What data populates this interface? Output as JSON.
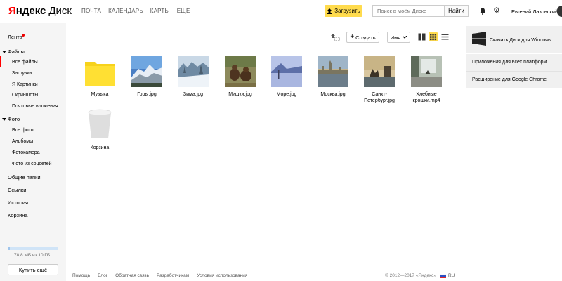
{
  "header": {
    "logo_y": "Я",
    "logo_rest": "ндекс",
    "logo_service": "Диск",
    "nav": [
      "ПОЧТА",
      "КАЛЕНДАРЬ",
      "КАРТЫ",
      "ЕЩЁ"
    ],
    "upload_label": "Загрузить",
    "search_placeholder": "Поиск в моём Диске",
    "search_button": "Найти",
    "username": "Евгений Лазовский"
  },
  "sidebar": {
    "feed": "Лента",
    "files": "Файлы",
    "file_items": [
      "Все файлы",
      "Загрузки",
      "Я Картинки",
      "Скриншоты",
      "Почтовые вложения"
    ],
    "photo": "Фото",
    "photo_items": [
      "Все фото",
      "Альбомы",
      "Фотокамера",
      "Фото из соцсетей"
    ],
    "shared": "Общие папки",
    "links": "Ссылки",
    "history": "История",
    "trash": "Корзина",
    "quota_text": "78,8 МБ из 10 ГБ",
    "quota_fraction": 0.01,
    "buy_more": "Купить ещё"
  },
  "toolbar": {
    "create_label": "Создать",
    "sort_label": "Имя"
  },
  "files": [
    {
      "name": "Музыка",
      "icon": "folder-icon"
    },
    {
      "name": "Горы.jpg",
      "icon": "mountains-photo"
    },
    {
      "name": "Зима.jpg",
      "icon": "winter-photo"
    },
    {
      "name": "Мишки.jpg",
      "icon": "bears-photo"
    },
    {
      "name": "Море.jpg",
      "icon": "sea-photo"
    },
    {
      "name": "Москва.jpg",
      "icon": "moscow-photo"
    },
    {
      "name": "Санкт-",
      "name2": "Петербург.jpg",
      "icon": "spb-photo"
    },
    {
      "name": "Хлебные",
      "name2": "крошки.mp4",
      "icon": "video-thumb"
    },
    {
      "name": "Корзина",
      "icon": "trash-bin-icon"
    }
  ],
  "promo": {
    "windows": "Скачать Диск для Windows",
    "all_platforms": "Приложения для всех платформ",
    "chrome": "Расширение для Google Chrome"
  },
  "footer": {
    "links": [
      "Помощь",
      "Блог",
      "Обратная связь",
      "Разработчикам",
      "Условия использования"
    ],
    "copyright": "© 2012—2017 «Яндекс»",
    "lang": "RU"
  },
  "colors": {
    "accent_yellow": "#ffdb4d",
    "active_red": "#ff0000",
    "sidebar_bg": "#f5f5f5"
  }
}
